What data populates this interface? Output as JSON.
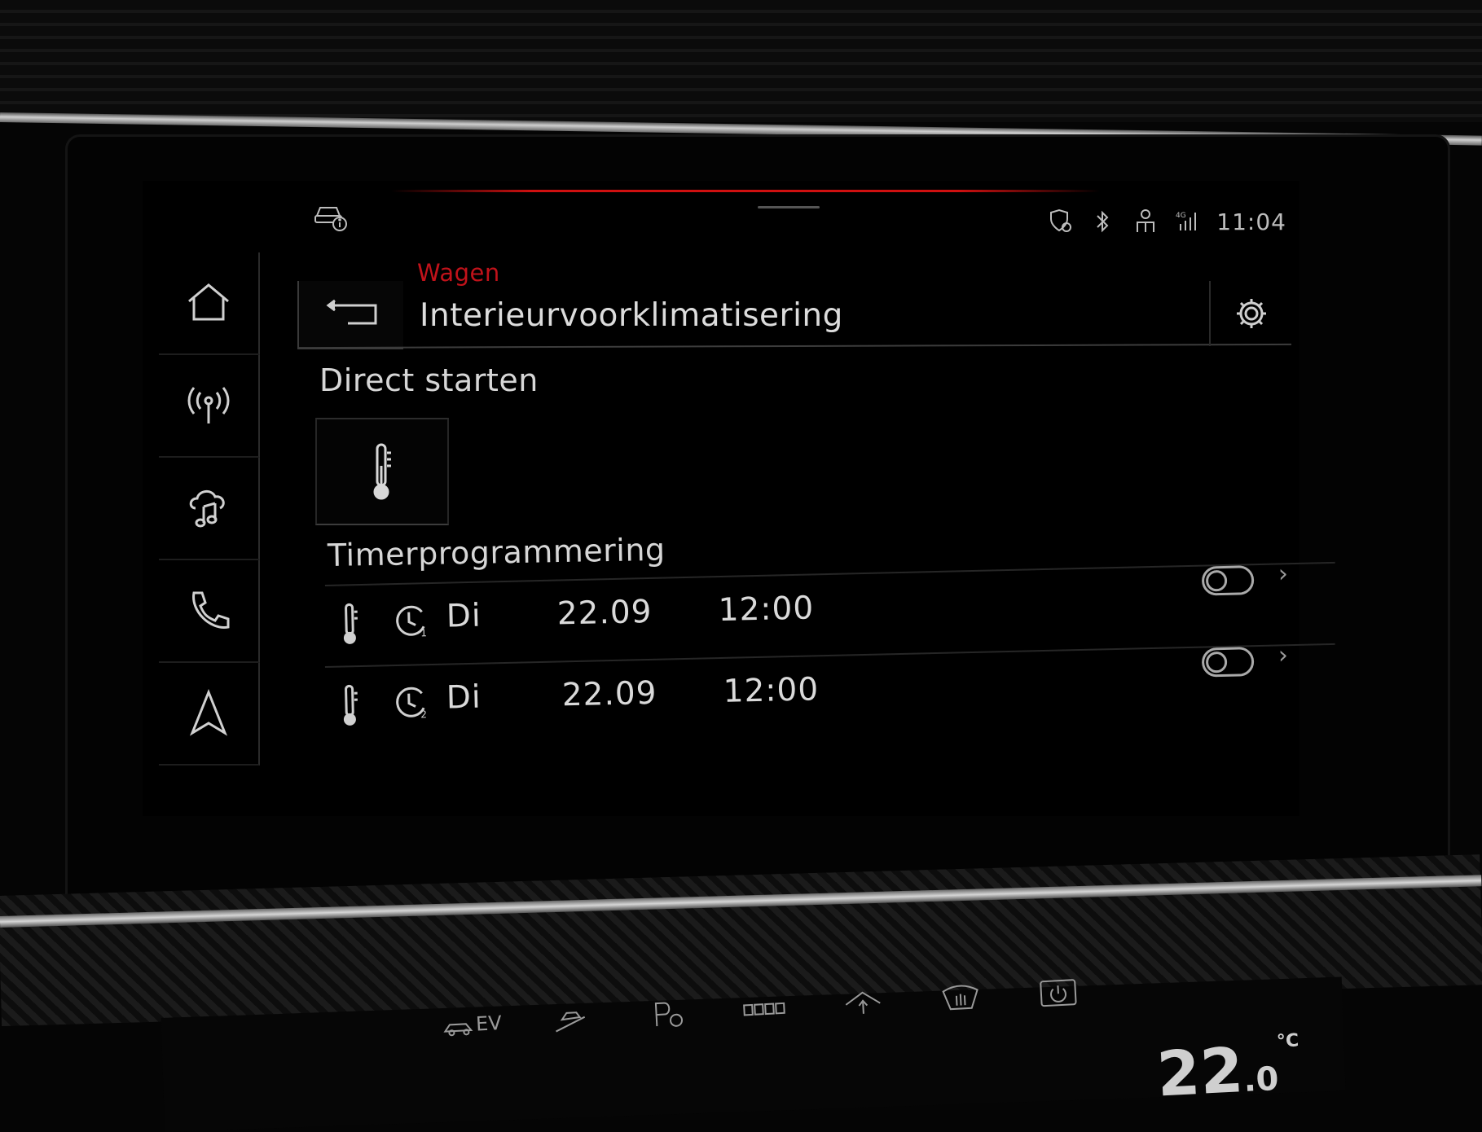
{
  "status_bar": {
    "time": "11:04",
    "icons": [
      "car-info-icon",
      "location-shield-icon",
      "bluetooth-icon",
      "person-icon",
      "signal-icon"
    ],
    "signal_label": "4G"
  },
  "sidebar": {
    "items": [
      {
        "icon": "home-icon"
      },
      {
        "icon": "radio-icon"
      },
      {
        "icon": "media-icon"
      },
      {
        "icon": "phone-icon"
      },
      {
        "icon": "navigation-icon"
      }
    ]
  },
  "header": {
    "breadcrumb": "Wagen",
    "title": "Interieurvoorklimatisering",
    "back_icon": "back-arrow-icon",
    "settings_icon": "gear-icon"
  },
  "direct_start": {
    "title": "Direct starten",
    "tile_icon": "thermometer-icon"
  },
  "timers": {
    "title": "Timerprogrammering",
    "rows": [
      {
        "number": "1",
        "day": "Di",
        "date": "22.09",
        "time": "12:00"
      },
      {
        "number": "2",
        "day": "Di",
        "date": "22.09",
        "time": "12:00"
      }
    ]
  },
  "lower_panel": {
    "ev_label": "EV",
    "temperature_main": "22",
    "temperature_decimal": ".0",
    "temperature_unit": "°C"
  },
  "colors": {
    "accent_red": "#c1121a",
    "text": "#dcdcdc",
    "background": "#000000"
  }
}
